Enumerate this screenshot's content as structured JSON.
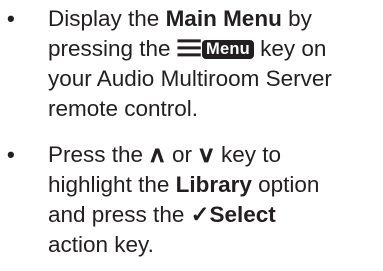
{
  "instructions": [
    {
      "bullet": "•",
      "lines": [
        {
          "before": "Display the ",
          "bold": "Main Menu",
          "after": " by"
        },
        {
          "before": "pressing the ",
          "icon_glyph": "☰",
          "key_label": "Menu",
          "after": " key on"
        },
        {
          "text": "your Audio Multiroom Server"
        },
        {
          "text": "remote control."
        }
      ]
    },
    {
      "bullet": "•",
      "lines": [
        {
          "before": "Press the ",
          "up_arrow": "∧",
          "middle": " or ",
          "down_arrow": "∨",
          "after": " key to"
        },
        {
          "before": "highlight the ",
          "bold": "Library",
          "after": " option"
        },
        {
          "before": "and press the ",
          "check_mark": "✓",
          "bold": "Select"
        },
        {
          "text": "action key."
        }
      ]
    }
  ],
  "icons": {
    "menu_key_icon": "menu-list-icon",
    "up_key_icon": "up-arrow-icon",
    "down_key_icon": "down-arrow-icon",
    "select_icon": "checkmark-icon"
  },
  "colors": {
    "text": "#231f20",
    "key_background": "#231f20",
    "key_text": "#ffffff"
  }
}
